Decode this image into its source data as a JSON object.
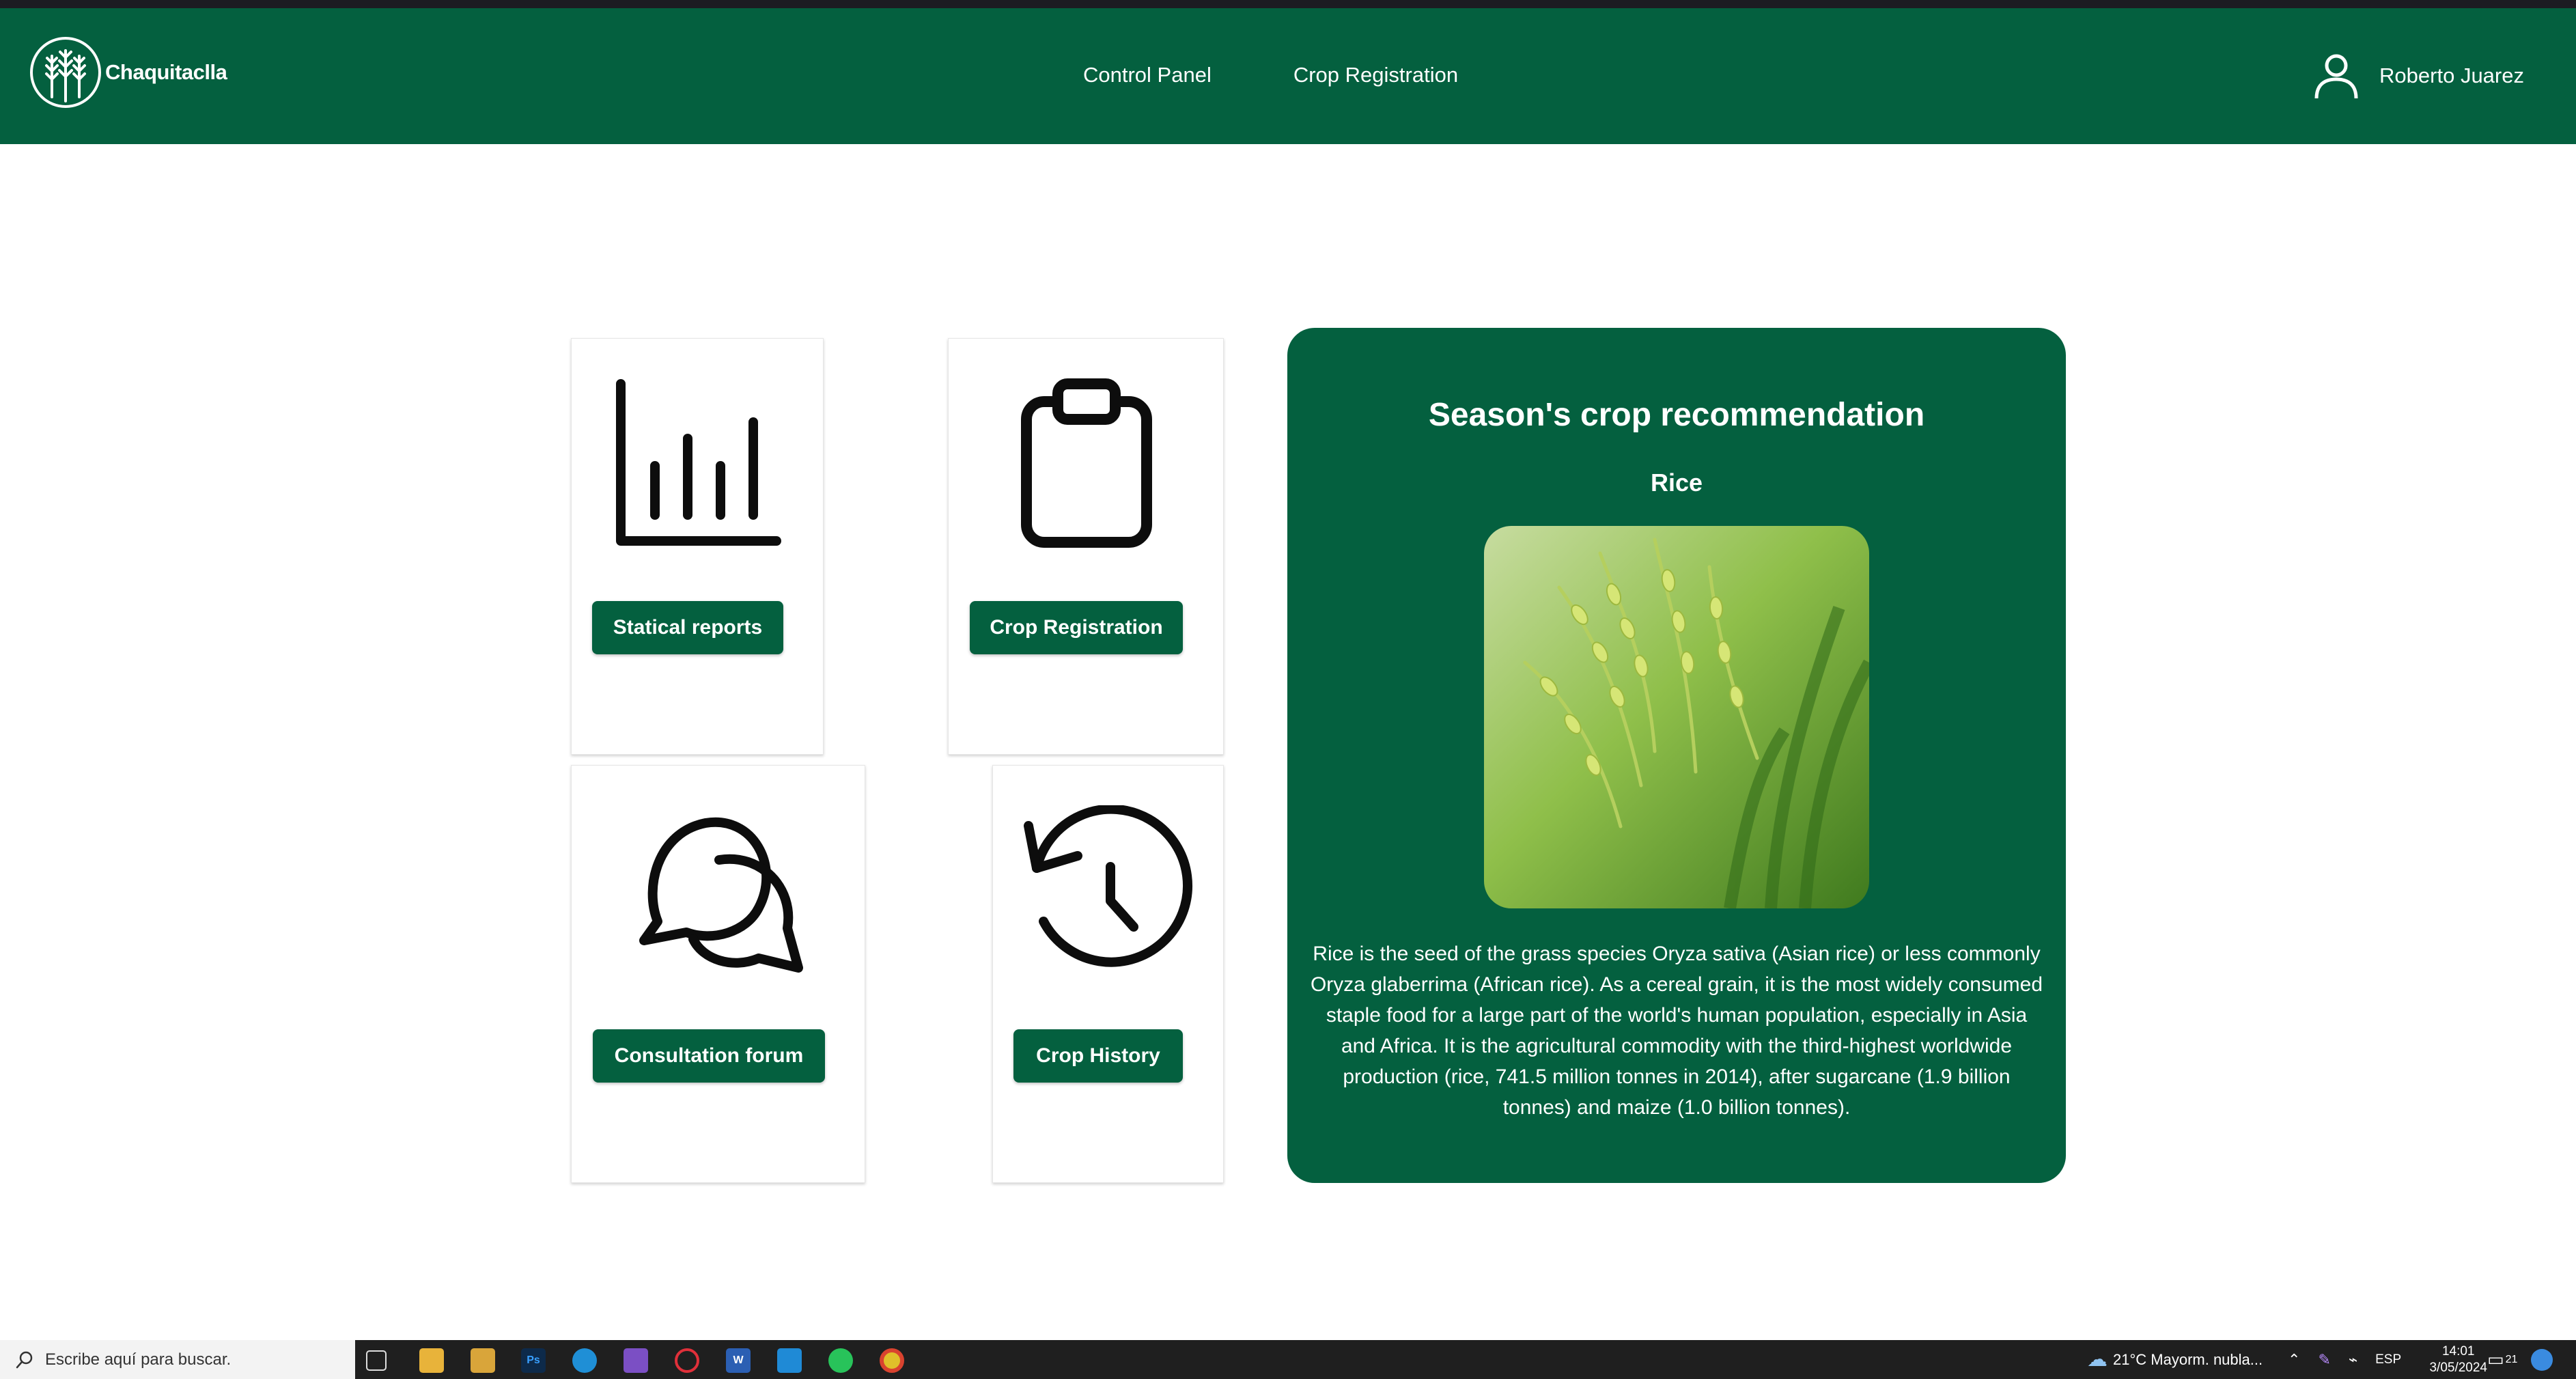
{
  "app": {
    "brand": "Chaquitaclla",
    "accent": "#04603f"
  },
  "nav": {
    "links": [
      "Control Panel",
      "Crop Registration"
    ],
    "user_name": "Roberto Juarez",
    "user_icon": "user-icon"
  },
  "cards": [
    {
      "icon": "bar-chart-icon",
      "button": "Statical reports"
    },
    {
      "icon": "clipboard-icon",
      "button": "Crop Registration"
    },
    {
      "icon": "chat-bubbles-icon",
      "button": "Consultation forum"
    },
    {
      "icon": "history-icon",
      "button": "Crop History"
    }
  ],
  "recommendation": {
    "title": "Season's crop recommendation",
    "crop": "Rice",
    "description": "Rice is the seed of the grass species Oryza sativa (Asian rice) or less commonly Oryza glaberrima (African rice). As a cereal grain, it is the most widely consumed staple food for a large part of the world's human population, especially in Asia and Africa. It is the agricultural commodity with the third-highest worldwide production (rice, 741.5 million tonnes in 2014), after sugarcane (1.9 billion tonnes) and maize (1.0 billion tonnes)."
  },
  "taskbar": {
    "search_placeholder": "Escribe aquí para buscar.",
    "apps": [
      "file-explorer-icon",
      "store-icon",
      "photoshop-icon",
      "edge-icon",
      "visual-studio-icon",
      "opera-icon",
      "word-icon",
      "vscode-icon",
      "whatsapp-icon",
      "chrome-icon"
    ],
    "ps_label": "Ps",
    "word_label": "W",
    "weather": "21°C  Mayorm. nubla...",
    "language": "ESP",
    "time": "14:01",
    "date": "3/05/2024",
    "notifications": "21"
  }
}
